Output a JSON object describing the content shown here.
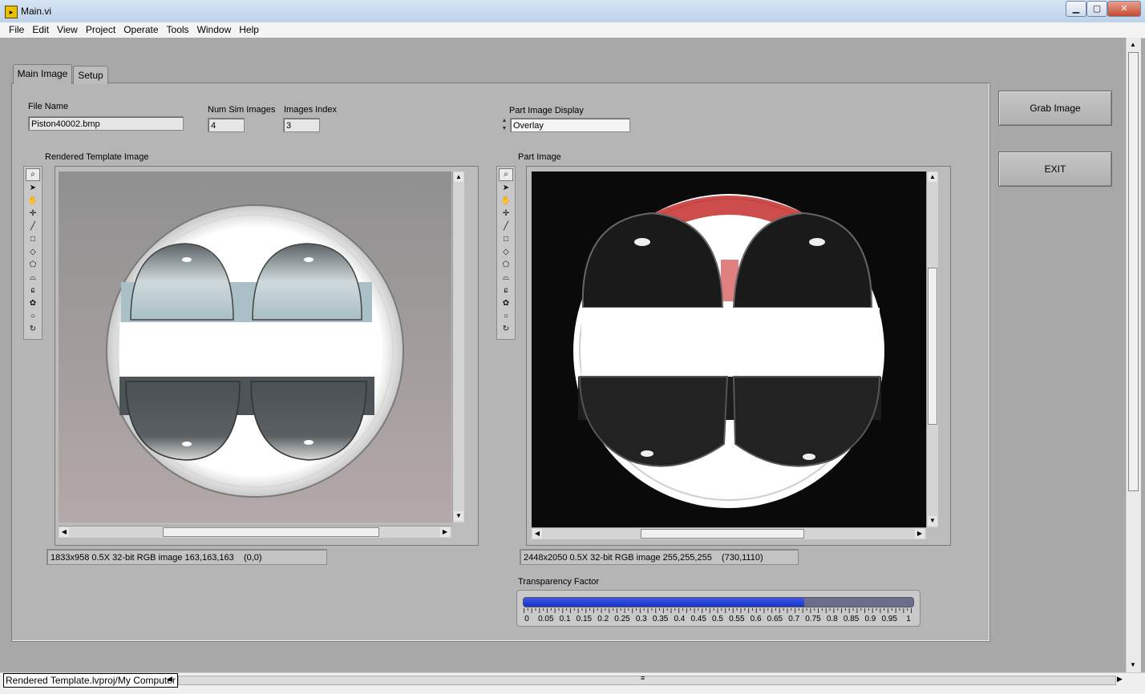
{
  "window": {
    "title": "Main.vi",
    "icon": "labview-vi-icon"
  },
  "menu": [
    "File",
    "Edit",
    "View",
    "Project",
    "Operate",
    "Tools",
    "Window",
    "Help"
  ],
  "tabs": [
    {
      "label": "Main Image",
      "active": true
    },
    {
      "label": "Setup",
      "active": false
    }
  ],
  "controls": {
    "file_name": {
      "label": "File Name",
      "value": "Piston40002.bmp"
    },
    "num_sim_images": {
      "label": "Num Sim Images",
      "value": "4"
    },
    "images_index": {
      "label": "Images Index",
      "value": "3"
    },
    "part_image_display": {
      "label": "Part Image Display",
      "value": "Overlay"
    }
  },
  "rendered_template": {
    "label": "Rendered Template Image",
    "status": "1833x958 0.5X 32-bit RGB image 163,163,163    (0,0)"
  },
  "part_image": {
    "label": "Part Image",
    "status": "2448x2050 0.5X 32-bit RGB image 255,255,255    (730,1110)"
  },
  "buttons": {
    "grab_image": "Grab Image",
    "exit": "EXIT"
  },
  "transparency": {
    "label": "Transparency Factor",
    "value": 0.72,
    "ticks": [
      "0",
      "0.05",
      "0.1",
      "0.15",
      "0.2",
      "0.25",
      "0.3",
      "0.35",
      "0.4",
      "0.45",
      "0.5",
      "0.55",
      "0.6",
      "0.65",
      "0.7",
      "0.75",
      "0.8",
      "0.85",
      "0.9",
      "0.95",
      "1"
    ]
  },
  "status_bar": {
    "context": "Rendered Template.lvproj/My Computer"
  },
  "colors": {
    "slider_fill": "#2a46e0",
    "overlay_red": "#c02020",
    "panel": "#b5b5b5"
  },
  "tool_icons": [
    "zoom-icon",
    "pointer-icon",
    "pan-icon",
    "point-icon",
    "line-icon",
    "rectangle-icon",
    "rotated-rectangle-icon",
    "polygon-icon",
    "freehand-icon",
    "freehand-line-icon",
    "annulus-icon",
    "oval-icon",
    "broken-line-icon"
  ]
}
